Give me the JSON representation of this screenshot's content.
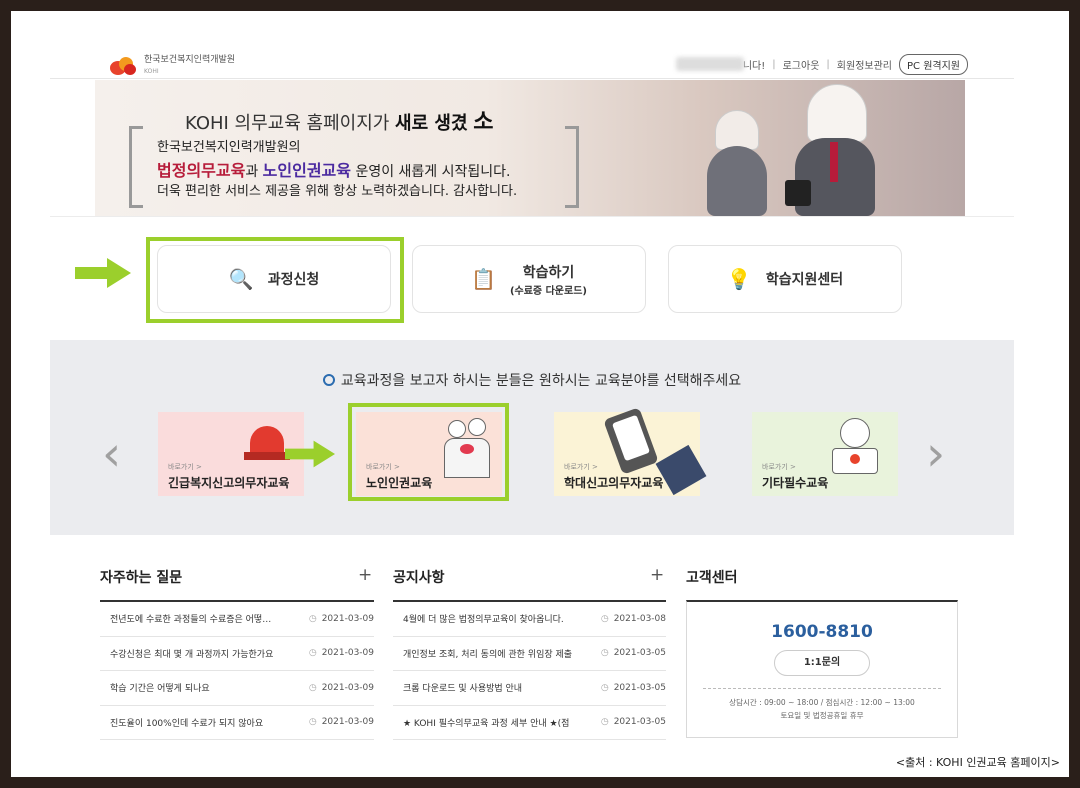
{
  "header": {
    "logo_text": "한국보건복지인력개발원",
    "logo_sub": "KOHI",
    "greeting_tail": "니다!",
    "logout": "로그아웃",
    "member": "회원정보관리",
    "pc_remote": "PC 원격지원",
    "separator": "|"
  },
  "banner": {
    "headline_pre": "KOHI 의무교육 홈페이지가 ",
    "headline_bold": "새로 생겼",
    "headline_glyph": "소",
    "line1": "한국보건복지인력개발원의",
    "line2_a": "법정의무교육",
    "line2_b": "과 ",
    "line2_c": "노인인권교육",
    "line2_d": " 운영이 새롭게 시작됩니다.",
    "line3": "더욱 편리한 서비스 제공을 위해 항상 노력하겠습니다. 감사합니다."
  },
  "quick_menu": [
    {
      "label": "과정신청",
      "icon": "document-search-icon",
      "glyph": "🔍"
    },
    {
      "label": "학습하기",
      "sub": "(수료증 다운로드)",
      "icon": "clipboard-icon",
      "glyph": "📋"
    },
    {
      "label": "학습지원센터",
      "icon": "lightbulb-icon",
      "glyph": "💡"
    }
  ],
  "field_select": {
    "prompt": "교육과정을 보고자 하시는 분들은 원하시는 교육분야를 선택해주세요",
    "prev": "‹",
    "next": "›",
    "cards": [
      {
        "go": "바로가기 >",
        "title": "긴급복지신고의무자교육",
        "color": "#fadcdc"
      },
      {
        "go": "바로가기 >",
        "title": "노인인권교육",
        "color": "#fbe1d8"
      },
      {
        "go": "바로가기 >",
        "title": "학대신고의무자교육",
        "color": "#fbf3d6"
      },
      {
        "go": "바로가기 >",
        "title": "기타필수교육",
        "color": "#e9f3dc"
      }
    ]
  },
  "faq": {
    "title": "자주하는 질문",
    "plus": "+",
    "items": [
      {
        "text": "전년도에 수료한 과정들의 수료증은 어떻…",
        "date": "2021-03-09"
      },
      {
        "text": "수강신청은 최대 몇 개 과정까지 가능한가요",
        "date": "2021-03-09"
      },
      {
        "text": "학습 기간은 어떻게 되나요",
        "date": "2021-03-09"
      },
      {
        "text": "진도율이 100%인데 수료가 되지 않아요",
        "date": "2021-03-09"
      }
    ]
  },
  "notice": {
    "title": "공지사항",
    "plus": "+",
    "items": [
      {
        "text": "4월에 더 많은 법정의무교육이 찾아옵니다.",
        "date": "2021-03-08"
      },
      {
        "text": "개인정보 조회, 처리 동의에 관한 위임장 제출",
        "date": "2021-03-05"
      },
      {
        "text": "크롬 다운로드 및 사용방법 안내",
        "date": "2021-03-05"
      },
      {
        "text": "★ KOHI 필수의무교육 과정 세부 안내 ★(점",
        "date": "2021-03-05"
      }
    ]
  },
  "customer_center": {
    "title": "고객센터",
    "phone": "1600-8810",
    "inquiry": "1:1문의",
    "hours1": "상담시간 : 09:00 ~ 18:00 / 점심시간 : 12:00 ~ 13:00",
    "hours2": "토요일 및 법정공휴일 휴무"
  },
  "caption": "<출처 : KOHI 인권교육 홈페이지>",
  "colors": {
    "highlight": "#9bcf2c",
    "accent_blue": "#2b5f9e"
  }
}
